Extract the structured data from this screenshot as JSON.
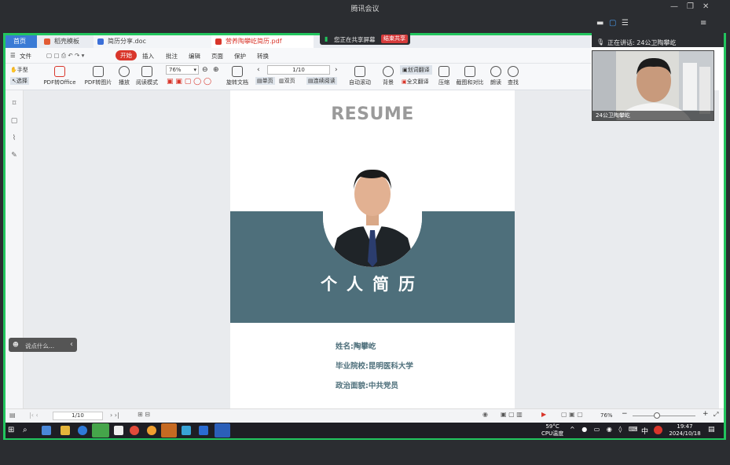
{
  "window": {
    "title": "腾讯会议"
  },
  "tabs": [
    {
      "label": "首页",
      "color": "#3a7bd5"
    },
    {
      "label": "稻壳模板",
      "color": "#e25b34"
    },
    {
      "label": "简历分享.doc",
      "color": "#3b6fd8"
    },
    {
      "label": "营养陶攀屹简历.pdf",
      "color": "#d9362b"
    }
  ],
  "menu": {
    "file": "文件",
    "items": [
      "开始",
      "插入",
      "批注",
      "编辑",
      "页面",
      "保护",
      "转换"
    ]
  },
  "toolbar": {
    "hand": "手型",
    "select": "选择",
    "pdf_to_office": "PDF转Office",
    "pdf_to_image": "PDF转图片",
    "play": "播放",
    "read_mode": "阅读模式",
    "zoom": "76%",
    "rotate": "旋转文档",
    "single": "单页",
    "double": "双页",
    "continuous": "连续阅读",
    "page": "1/10",
    "auto_scroll": "自动滚动",
    "background": "背景",
    "translate_select": "划词翻译",
    "translate_all": "全文翻译",
    "compress": "压缩",
    "screenshot_compare": "截图和对比",
    "read_aloud": "朗读",
    "search": "查找"
  },
  "share": {
    "status": "您正在共享屏幕",
    "stop": "结束共享"
  },
  "meeting": {
    "speaking": "正在讲话: 24公卫陶攀屹",
    "name": "24公卫陶攀屹"
  },
  "doc": {
    "resume": "RESUME",
    "title_cn": "个人简历",
    "info": [
      {
        "label": "姓名:",
        "value": "陶攀屹"
      },
      {
        "label": "毕业院校:",
        "value": "昆明医科大学"
      },
      {
        "label": "政治面貌:",
        "value": "中共党员"
      }
    ]
  },
  "chat": {
    "placeholder": "说点什么..."
  },
  "statusbar": {
    "page": "1/10",
    "zoom": "76%"
  },
  "taskbar": {
    "temp": "59°C",
    "temp_label": "CPU温度",
    "ime": "中",
    "time": "19:47",
    "date": "2024/10/18"
  }
}
